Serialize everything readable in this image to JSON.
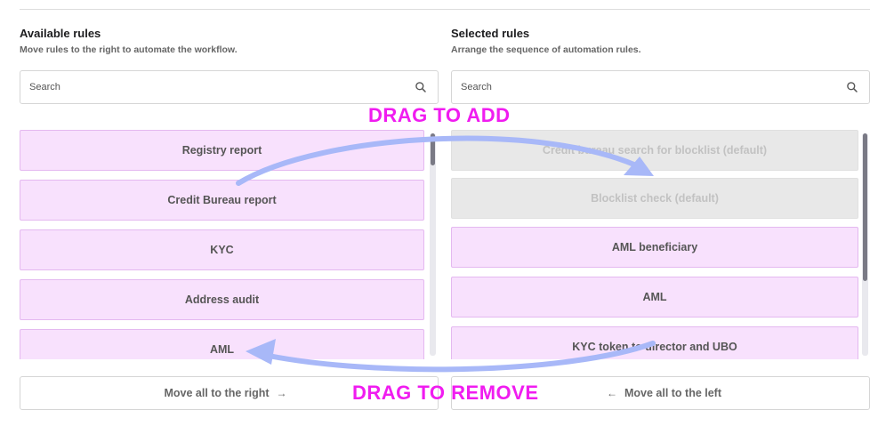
{
  "available": {
    "title": "Available rules",
    "subtitle": "Move rules to the right to automate the workflow.",
    "search_placeholder": "Search",
    "items": [
      {
        "label": "Registry report"
      },
      {
        "label": "Credit Bureau report"
      },
      {
        "label": "KYC"
      },
      {
        "label": "Address audit"
      },
      {
        "label": "AML"
      }
    ],
    "move_all_label": "Move all to the right",
    "move_all_icon": "arrow-right-icon",
    "scroll_position": 0.0
  },
  "selected": {
    "title": "Selected rules",
    "subtitle": "Arrange the sequence of automation rules.",
    "search_placeholder": "Search",
    "items": [
      {
        "label": "Credit bureau search for blocklist (default)",
        "locked": true
      },
      {
        "label": "Blocklist check (default)",
        "locked": true
      },
      {
        "label": "AML beneficiary",
        "locked": false
      },
      {
        "label": "AML",
        "locked": false
      },
      {
        "label": "KYC token to director and UBO",
        "locked": false
      }
    ],
    "move_all_label": "Move all to the left",
    "move_all_icon": "arrow-left-icon",
    "scroll_position": 0.0
  },
  "annotations": {
    "add_label": "DRAG TO ADD",
    "remove_label": "DRAG TO REMOVE",
    "label_color": "#f01cf0",
    "arrow_color": "#a8b8f8"
  },
  "colors": {
    "rule_bg": "#f8e1fd",
    "rule_border": "#e4b8f0",
    "default_rule_bg": "#e8e8e8",
    "scroll_thumb": "#7a7a85"
  }
}
